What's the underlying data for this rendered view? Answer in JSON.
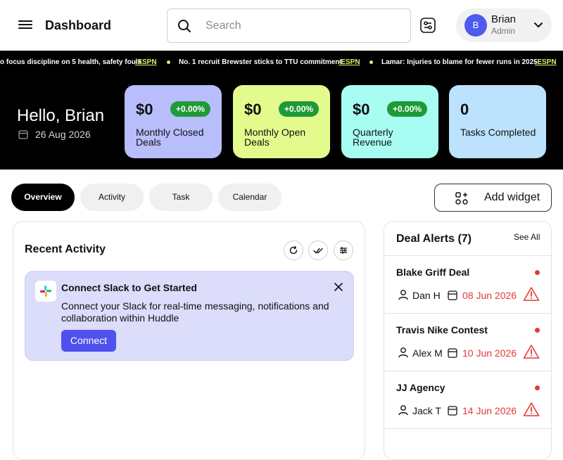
{
  "header": {
    "title": "Dashboard",
    "search_placeholder": "Search",
    "user": {
      "initial": "B",
      "name": "Brian",
      "role": "Admin"
    }
  },
  "ticker": [
    {
      "text": "o focus discipline on 5 health, safety fouls",
      "source": "-ESPN"
    },
    {
      "text": "No. 1 recruit Brewster sticks to TTU commitment",
      "source": "-ESPN"
    },
    {
      "text": "Lamar: Injuries to blame for fewer runs in 2025",
      "source": "-ESPN"
    }
  ],
  "banner": {
    "greeting": "Hello, Brian",
    "date": "26 Aug 2026",
    "cards": [
      {
        "value": "$0",
        "badge": "+0.00%",
        "label": "Monthly Closed Deals",
        "color": "#b8bdfb"
      },
      {
        "value": "$0",
        "badge": "+0.00%",
        "label": "Monthly Open Deals",
        "color": "#e3fb8c"
      },
      {
        "value": "$0",
        "badge": "+0.00%",
        "label": "Quarterly Revenue",
        "color": "#a8fdf3"
      },
      {
        "value": "0",
        "badge": "",
        "label": "Tasks Completed",
        "color": "#bde2fd"
      }
    ]
  },
  "tabs": [
    {
      "label": "Overview",
      "active": true
    },
    {
      "label": "Activity",
      "active": false
    },
    {
      "label": "Task",
      "active": false
    },
    {
      "label": "Calendar",
      "active": false
    }
  ],
  "add_widget_label": "Add widget",
  "activity": {
    "title": "Recent Activity",
    "slack": {
      "title": "Connect Slack to Get Started",
      "description": "Connect your Slack for real-time messaging, notifications and collaboration within Huddle",
      "button": "Connect"
    }
  },
  "alerts": {
    "title": "Deal Alerts (7)",
    "see_all": "See All",
    "deals": [
      {
        "name": "Blake Griff Deal",
        "person": "Dan H",
        "date": "08 Jun 2026"
      },
      {
        "name": "Travis Nike Contest",
        "person": "Alex M",
        "date": "10 Jun 2026"
      },
      {
        "name": "JJ Agency",
        "person": "Jack T",
        "date": "14 Jun 2026"
      }
    ]
  },
  "colors": {
    "accent": "#4f51ee",
    "badge_green": "#1f9a36",
    "alert_red": "#e53935",
    "ticker_source": "#d9f26b"
  }
}
